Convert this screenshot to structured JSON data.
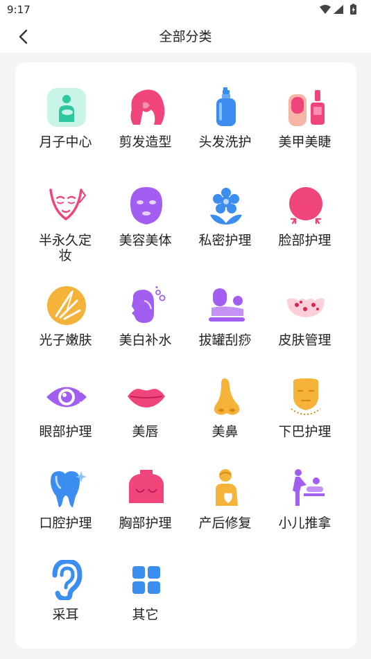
{
  "status_bar": {
    "time": "9:17"
  },
  "header": {
    "title": "全部分类"
  },
  "categories": [
    {
      "label": "月子中心",
      "icon": "postpartum-mother-icon"
    },
    {
      "label": "剪发造型",
      "icon": "hair-styling-icon"
    },
    {
      "label": "头发洗护",
      "icon": "shampoo-bottle-icon"
    },
    {
      "label": "美甲美睫",
      "icon": "nail-polish-icon"
    },
    {
      "label": "半永久定妆",
      "icon": "permanent-makeup-face-icon"
    },
    {
      "label": "美容美体",
      "icon": "face-mask-icon"
    },
    {
      "label": "私密护理",
      "icon": "flower-icon"
    },
    {
      "label": "脸部护理",
      "icon": "face-care-icon"
    },
    {
      "label": "光子嫩肤",
      "icon": "photon-light-icon"
    },
    {
      "label": "美白补水",
      "icon": "face-hydration-icon"
    },
    {
      "label": "拔罐刮痧",
      "icon": "cupping-massage-icon"
    },
    {
      "label": "皮肤管理",
      "icon": "skin-care-icon"
    },
    {
      "label": "眼部护理",
      "icon": "eye-icon"
    },
    {
      "label": "美唇",
      "icon": "lips-icon"
    },
    {
      "label": "美鼻",
      "icon": "nose-icon"
    },
    {
      "label": "下巴护理",
      "icon": "chin-icon"
    },
    {
      "label": "口腔护理",
      "icon": "tooth-icon"
    },
    {
      "label": "胸部护理",
      "icon": "chest-icon"
    },
    {
      "label": "产后修复",
      "icon": "postpartum-recovery-icon"
    },
    {
      "label": "小儿推拿",
      "icon": "baby-massage-icon"
    },
    {
      "label": "采耳",
      "icon": "ear-icon"
    },
    {
      "label": "其它",
      "icon": "grid-icon"
    }
  ],
  "colors": {
    "teal": "#2ec7a0",
    "pink": "#f0457a",
    "blue": "#3b8df0",
    "purple": "#a25ef0",
    "orange": "#f5b33a"
  }
}
